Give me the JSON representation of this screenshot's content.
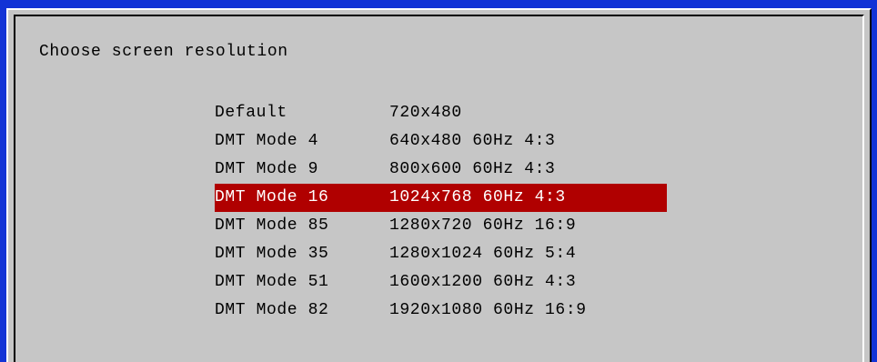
{
  "dialog": {
    "title": "Choose screen resolution"
  },
  "menu": {
    "items": [
      {
        "tag": "Default",
        "desc": "720x480"
      },
      {
        "tag": "DMT Mode 4",
        "desc": "640x480 60Hz 4:3"
      },
      {
        "tag": "DMT Mode 9",
        "desc": "800x600 60Hz 4:3"
      },
      {
        "tag": "DMT Mode 16",
        "desc": "1024x768 60Hz 4:3"
      },
      {
        "tag": "DMT Mode 85",
        "desc": "1280x720 60Hz 16:9"
      },
      {
        "tag": "DMT Mode 35",
        "desc": "1280x1024 60Hz 5:4"
      },
      {
        "tag": "DMT Mode 51",
        "desc": "1600x1200 60Hz 4:3"
      },
      {
        "tag": "DMT Mode 82",
        "desc": "1920x1080 60Hz 16:9"
      }
    ],
    "selected_index": 3
  },
  "colors": {
    "background": "#1233d6",
    "dialog": "#c6c6c6",
    "selection": "#b00000"
  }
}
